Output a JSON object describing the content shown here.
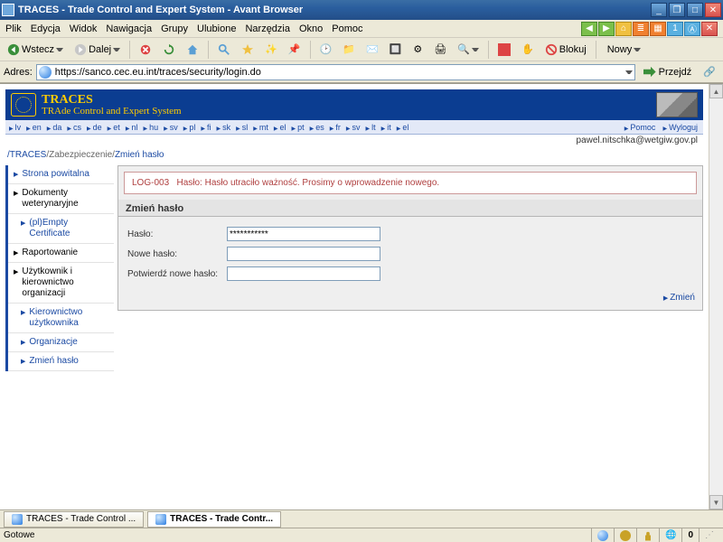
{
  "window": {
    "title": "TRACES - Trade Control and Expert System - Avant Browser"
  },
  "menubar": [
    "Plik",
    "Edycja",
    "Widok",
    "Nawigacja",
    "Grupy",
    "Ulubione",
    "Narzędzia",
    "Okno",
    "Pomoc"
  ],
  "toolbar": {
    "back_label": "Wstecz",
    "forward_label": "Dalej",
    "block_label": "Blokuj",
    "new_label": "Nowy"
  },
  "address": {
    "label": "Adres:",
    "url": "https://sanco.cec.eu.int/traces/security/login.do",
    "go_label": "Przejdź"
  },
  "banner": {
    "title": "TRACES",
    "subtitle": "TRAde Control and Expert System"
  },
  "langs": [
    "lv",
    "en",
    "da",
    "cs",
    "de",
    "et",
    "nl",
    "hu",
    "sv",
    "pl",
    "fi",
    "sk",
    "sl",
    "mt",
    "el",
    "pt",
    "es",
    "fr",
    "sv",
    "lt",
    "it",
    "el"
  ],
  "header_links": {
    "help": "Pomoc",
    "logout": "Wyloguj"
  },
  "user_line": "pawel.nitschka@wetgiw.gov.pl",
  "breadcrumb": {
    "root": "/TRACES",
    "mid": "/Zabezpieczenie/",
    "leaf": "Zmień hasło"
  },
  "sidebar": {
    "items": [
      {
        "label": "Strona powitalna",
        "style": "link"
      },
      {
        "label": "Dokumenty weterynaryjne",
        "style": "black"
      },
      {
        "label": "(pl)Empty Certificate",
        "style": "link sub"
      },
      {
        "label": "Raportowanie",
        "style": "black"
      },
      {
        "label": "Użytkownik i kierownictwo organizacji",
        "style": "black"
      },
      {
        "label": "Kierownictwo użytkownika",
        "style": "link sub"
      },
      {
        "label": "Organizacje",
        "style": "link sub"
      },
      {
        "label": "Zmień hasło",
        "style": "link sub"
      }
    ]
  },
  "error": {
    "code": "LOG-003",
    "text": "Hasło: Hasło utraciło ważność. Prosimy o wprowadzenie nowego."
  },
  "form": {
    "title": "Zmień hasło",
    "password_label": "Hasło:",
    "password_value": "***********",
    "new_label": "Nowe hasło:",
    "confirm_label": "Potwierdź nowe hasło:",
    "submit_label": "Zmień"
  },
  "taskbar": {
    "tab1": "TRACES - Trade Control ...",
    "tab2": "TRACES - Trade Contr..."
  },
  "statusbar": {
    "status": "Gotowe",
    "count": "0"
  }
}
